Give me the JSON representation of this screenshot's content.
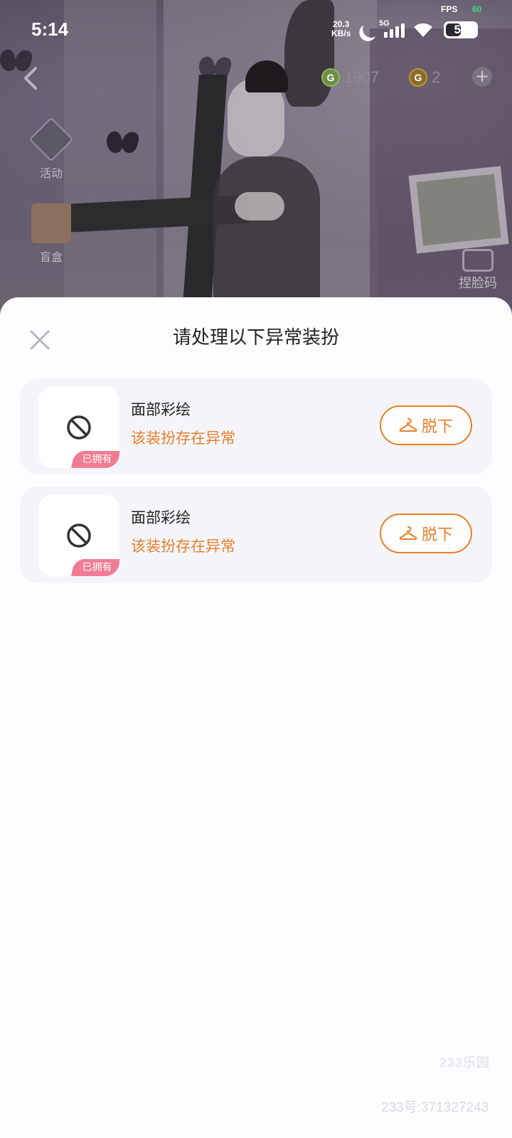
{
  "status_bar": {
    "time": "5:14",
    "fps_label": "FPS",
    "fps_value": "60",
    "speed_value": "20.3",
    "speed_unit": "KB/s",
    "network": "5G",
    "battery": "50",
    "battery_level": 0.5
  },
  "game_header": {
    "green_currency": "1907",
    "gold_currency": "2",
    "green_coin_letter": "G",
    "gold_coin_letter": "G",
    "add_label": "+"
  },
  "side_menu": {
    "activity_label": "活动",
    "blindbox_label": "盲盒",
    "pinch_face_label": "捏脸码"
  },
  "dialog": {
    "title": "请处理以下异常装扮",
    "items": [
      {
        "name": "面部彩绘",
        "warning": "该装扮存在异常",
        "badge": "已拥有",
        "action": "脱下"
      },
      {
        "name": "面部彩绘",
        "warning": "该装扮存在异常",
        "badge": "已拥有",
        "action": "脱下"
      }
    ]
  },
  "watermark": {
    "logo": "233乐园",
    "id": "233号:371327243"
  },
  "colors": {
    "accent": "#e57f2b",
    "badge": "#f07c94",
    "sheet_bg": "#fdfdff",
    "card_bg": "#f5f5f9"
  },
  "icons": [
    "back-icon",
    "moon-icon",
    "signal-icon",
    "wifi-icon",
    "battery-icon",
    "add-icon",
    "close-icon",
    "ban-icon",
    "hanger-icon"
  ]
}
